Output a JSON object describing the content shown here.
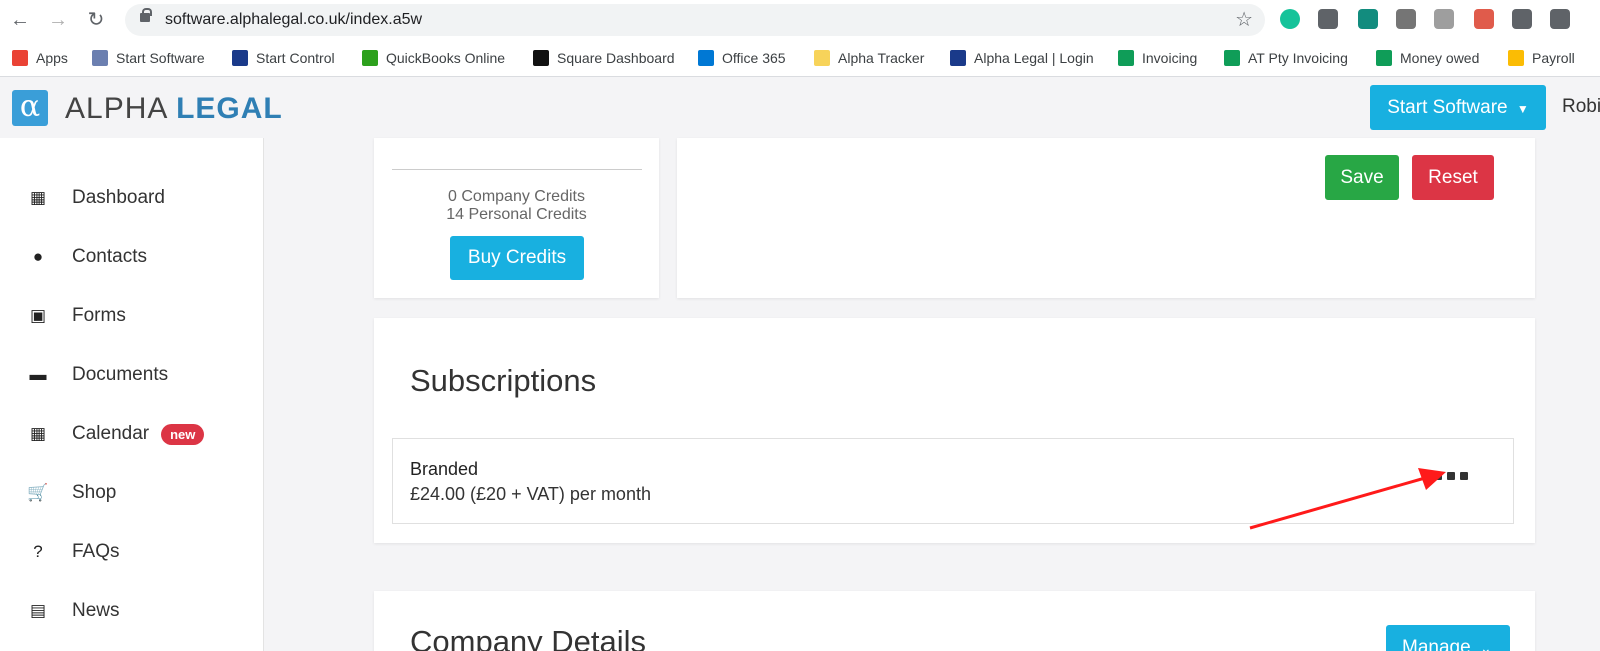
{
  "browser": {
    "url": "software.alphalegal.co.uk/index.a5w",
    "bookmarks": [
      {
        "label": "Apps",
        "color": "#ea4335"
      },
      {
        "label": "Start Software",
        "color": "#6b7fb0"
      },
      {
        "label": "Start Control",
        "color": "#1a3a8a"
      },
      {
        "label": "QuickBooks Online",
        "color": "#2ca01c"
      },
      {
        "label": "Square Dashboard",
        "color": "#111111"
      },
      {
        "label": "Office 365",
        "color": "#0078d4"
      },
      {
        "label": "Alpha Tracker",
        "color": "#f7d35a"
      },
      {
        "label": "Alpha Legal | Login",
        "color": "#1a3a8a"
      },
      {
        "label": "Invoicing",
        "color": "#0f9d58"
      },
      {
        "label": "AT Pty Invoicing",
        "color": "#0f9d58"
      },
      {
        "label": "Money owed",
        "color": "#0f9d58"
      },
      {
        "label": "Payroll",
        "color": "#fbbc04"
      }
    ],
    "extensions": [
      "#15c39a",
      "#5f6368",
      "#128c7e",
      "#757575",
      "#9e9e9e",
      "#e05b4b",
      "#5f6368",
      "#5f6368"
    ]
  },
  "header": {
    "logo_light": "ALPHA",
    "logo_bold": "LEGAL",
    "start_software": "Start Software",
    "user": "Robi"
  },
  "sidebar": {
    "items": [
      {
        "label": "Dashboard",
        "icon": "dashboard-icon"
      },
      {
        "label": "Contacts",
        "icon": "user-icon"
      },
      {
        "label": "Forms",
        "icon": "file-icon"
      },
      {
        "label": "Documents",
        "icon": "folder-icon"
      },
      {
        "label": "Calendar",
        "icon": "calendar-icon",
        "badge": "new"
      },
      {
        "label": "Shop",
        "icon": "cart-icon"
      },
      {
        "label": "FAQs",
        "icon": "question-icon"
      },
      {
        "label": "News",
        "icon": "newspaper-icon"
      }
    ]
  },
  "credits": {
    "company": "0 Company Credits",
    "personal": "14 Personal Credits",
    "buy_label": "Buy Credits"
  },
  "form_actions": {
    "save": "Save",
    "reset": "Reset"
  },
  "subscriptions": {
    "title": "Subscriptions",
    "items": [
      {
        "name": "Branded",
        "price": "£24.00 (£20 + VAT) per month"
      }
    ]
  },
  "company_details": {
    "title": "Company Details",
    "manage": "Manage"
  },
  "colors": {
    "primary": "#18b0e0",
    "success": "#28a745",
    "danger": "#dc3545",
    "annotation_arrow": "#ff1a1a"
  }
}
